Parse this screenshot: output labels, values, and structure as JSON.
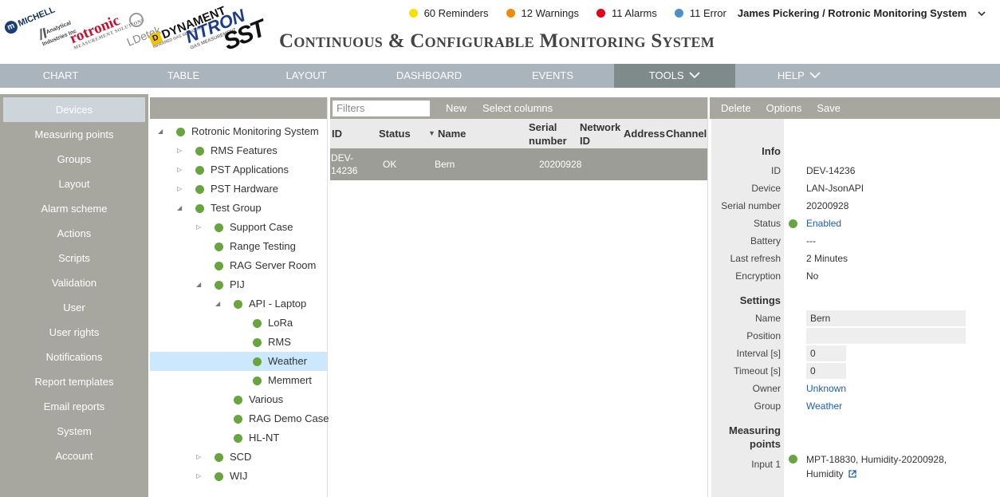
{
  "header": {
    "title": "Continuous & Configurable Monitoring System",
    "logos": {
      "michell": "MICHELL",
      "analytical": "Analytical Industries Inc",
      "rotronic": "rotronic",
      "rotronic_sub": "MEASUREMENT SOLUTIONS",
      "ldetek": "LDetek",
      "dynament": "DYNAMENT",
      "dynament_sub": "INFRARED GAS SENSORS",
      "ntron": "NTRON",
      "ntron_sub": "GAS MEASUREMENT",
      "sst": "SST"
    },
    "status": [
      {
        "label": "60 Reminders",
        "color": "#f5e100"
      },
      {
        "label": "12 Warnings",
        "color": "#f08a00"
      },
      {
        "label": "11 Alarms",
        "color": "#e3001b"
      },
      {
        "label": "11 Error",
        "color": "#4f8fc8"
      }
    ],
    "user": "James Pickering / Rotronic Monitoring System",
    "user_chevron": "❯"
  },
  "nav": [
    {
      "label": "CHART"
    },
    {
      "label": "TABLE"
    },
    {
      "label": "LAYOUT"
    },
    {
      "label": "DASHBOARD"
    },
    {
      "label": "EVENTS"
    },
    {
      "label": "TOOLS"
    },
    {
      "label": "HELP"
    }
  ],
  "sidebar": [
    "Devices",
    "Measuring points",
    "Groups",
    "Layout",
    "Alarm scheme",
    "Actions",
    "Scripts",
    "Validation",
    "User",
    "User rights",
    "Notifications",
    "Report templates",
    "Email reports",
    "System",
    "Account"
  ],
  "tree": [
    {
      "label": "Rotronic Monitoring System",
      "toggle": "◢"
    },
    {
      "label": "RMS Features",
      "toggle": "▷"
    },
    {
      "label": "PST Applications",
      "toggle": "▷"
    },
    {
      "label": "PST Hardware",
      "toggle": "▷"
    },
    {
      "label": "Test Group",
      "toggle": "◢"
    },
    {
      "label": "Support Case",
      "toggle": "▷"
    },
    {
      "label": "Range Testing",
      "toggle": ""
    },
    {
      "label": "RAG Server Room",
      "toggle": ""
    },
    {
      "label": "PIJ",
      "toggle": "◢"
    },
    {
      "label": "API - Laptop",
      "toggle": "◢"
    },
    {
      "label": "LoRa",
      "toggle": ""
    },
    {
      "label": "RMS",
      "toggle": ""
    },
    {
      "label": "Weather",
      "toggle": ""
    },
    {
      "label": "Memmert",
      "toggle": ""
    },
    {
      "label": "Various",
      "toggle": ""
    },
    {
      "label": "RAG Demo Case",
      "toggle": ""
    },
    {
      "label": "HL-NT",
      "toggle": ""
    },
    {
      "label": "SCD",
      "toggle": "▷"
    },
    {
      "label": "WIJ",
      "toggle": "▷"
    }
  ],
  "table": {
    "filter_placeholder": "Filters",
    "new_label": "New",
    "select_columns_label": "Select columns",
    "columns": {
      "id": "ID",
      "status": "Status",
      "name": "Name",
      "serial_line1": "Serial",
      "serial_line2": "number",
      "network_line1": "Network",
      "network_line2": "ID",
      "address": "Address",
      "channel": "Channel"
    },
    "sort_indicator": "▼",
    "rows": [
      {
        "id_line1": "DEV-",
        "id_line2": "14236",
        "status": "OK",
        "name": "Bern",
        "serial": "20200928"
      }
    ]
  },
  "details": {
    "toolbar": {
      "delete": "Delete",
      "options": "Options",
      "save": "Save"
    },
    "info_heading": "Info",
    "id_label": "ID",
    "id_value": "DEV-14236",
    "device_label": "Device",
    "device_value": "LAN-JsonAPI",
    "serial_label": "Serial number",
    "serial_value": "20200928",
    "status_label": "Status",
    "status_value": "Enabled",
    "battery_label": "Battery",
    "battery_value": "---",
    "refresh_label": "Last refresh",
    "refresh_value": "2 Minutes",
    "encryption_label": "Encryption",
    "encryption_value": "No",
    "settings_heading": "Settings",
    "name_label": "Name",
    "name_value": "Bern",
    "position_label": "Position",
    "position_value": "",
    "interval_label": "Interval [s]",
    "interval_value": "0",
    "timeout_label": "Timeout [s]",
    "timeout_value": "0",
    "owner_label": "Owner",
    "owner_value": "Unknown",
    "group_label": "Group",
    "group_value": "Weather",
    "mp_heading_line1": "Measuring",
    "mp_heading_line2": "points",
    "input1_label": "Input 1",
    "input1_value_line1": "MPT-18830, Humidity-20200928,",
    "input1_value_line2": "Humidity"
  },
  "colors": {
    "nav_bg": "#a9b4bd",
    "nav_active": "#7f8a8a",
    "sidebar_bg": "#a7a7a0",
    "tree_selected": "#cce8ff",
    "ok_green": "#67a63c",
    "link_blue": "#1a5fb4"
  }
}
